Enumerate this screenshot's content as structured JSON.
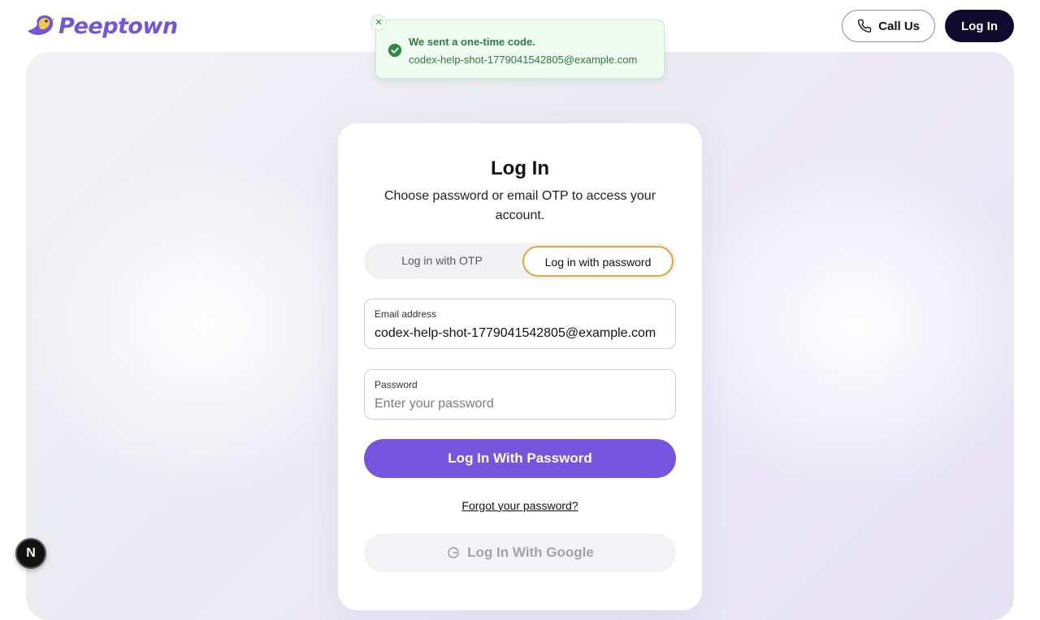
{
  "brand": {
    "name": "Peeptown",
    "accent": "#7655de"
  },
  "nav": {
    "call_label": "Call Us",
    "login_label": "Log In"
  },
  "toast": {
    "title": "We sent a one-time code.",
    "email": "codex-help-shot-1779041542805@example.com",
    "close_glyph": "✕"
  },
  "card": {
    "title": "Log In",
    "subtitle": "Choose password or email OTP to access your account.",
    "tabs": [
      {
        "label": "Log in with OTP",
        "selected": false
      },
      {
        "label": "Log in with password",
        "selected": true
      }
    ],
    "email": {
      "label": "Email address",
      "value": "codex-help-shot-1779041542805@example.com"
    },
    "password": {
      "label": "Password",
      "placeholder": "Enter your password",
      "value": ""
    },
    "submit_label": "Log In With Password",
    "forgot_label": "Forgot your password?",
    "google_label": "Log In With Google"
  },
  "dev_badge": {
    "label": "N"
  }
}
